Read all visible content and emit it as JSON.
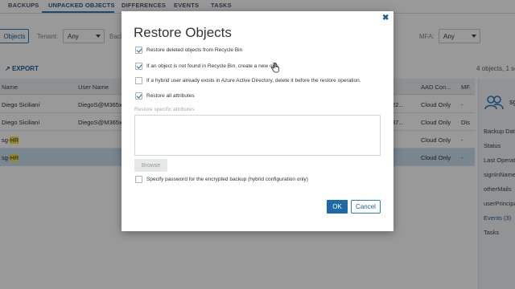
{
  "tabs": [
    {
      "label": "BACKUPS"
    },
    {
      "label": "UNPACKED OBJECTS"
    },
    {
      "label": "DIFFERENCES"
    },
    {
      "label": "EVENTS"
    },
    {
      "label": "TASKS"
    }
  ],
  "filters": {
    "objects_label": "Objects",
    "tenant_label": "Tenant:",
    "tenant_value": "Any",
    "back_label": "Back",
    "mfa_label": "MFA:",
    "mfa_value": "Any"
  },
  "toolbar": {
    "export_label": "EXPORT",
    "count_text": "4 objects, 1 se"
  },
  "grid": {
    "columns": [
      "Name",
      "User Name",
      "AAD Con...",
      "MF."
    ],
    "rows": [
      {
        "name": "Diego Siciliani",
        "user": "DiegoS@M365x4",
        "mid": "22...",
        "aad": "Cloud Only",
        "mf": "-"
      },
      {
        "name": "Diego Siciliani",
        "user": "DiegoS@M365x8",
        "mid": "87...",
        "aad": "Cloud Only",
        "mf": "Dis"
      },
      {
        "name_pre": "sg-",
        "name_hl": "HR",
        "user": "",
        "mid": "",
        "aad": "Cloud Only",
        "mf": "-"
      },
      {
        "name_pre": "sg-",
        "name_hl": "HR",
        "user": "",
        "mid": "",
        "aad": "Cloud Only",
        "mf": "-"
      }
    ]
  },
  "details": {
    "name": "sg",
    "items": [
      "Backup Dat",
      "Status",
      "Last Operat",
      "signInName",
      "otherMails",
      "userPrincipa",
      "Events (3)",
      "Tasks"
    ]
  },
  "modal": {
    "title": "Restore Objects",
    "close_glyph": "✖",
    "options": [
      {
        "label": "Restore deleted objects from Recycle Bin",
        "checked": true
      },
      {
        "label": "If an object is not found in Recycle Bin, create a new one",
        "checked": true
      },
      {
        "label": "If a hybrid user already exists in Azure Active Directory, delete it before the restore operation.",
        "checked": false
      },
      {
        "label": "Restore all attributes",
        "checked": true
      }
    ],
    "attributes_label": "Restore specific attributes",
    "browse_label": "Browse",
    "password_option": {
      "label": "Specify password for the encrypted backup (hybrid configuration only)",
      "checked": false
    },
    "ok_label": "OK",
    "cancel_label": "Cancel"
  },
  "colors": {
    "accent": "#1f6aa5",
    "link": "#1b5f92",
    "selected_row": "#c9dff0",
    "highlight": "#f5e642"
  }
}
